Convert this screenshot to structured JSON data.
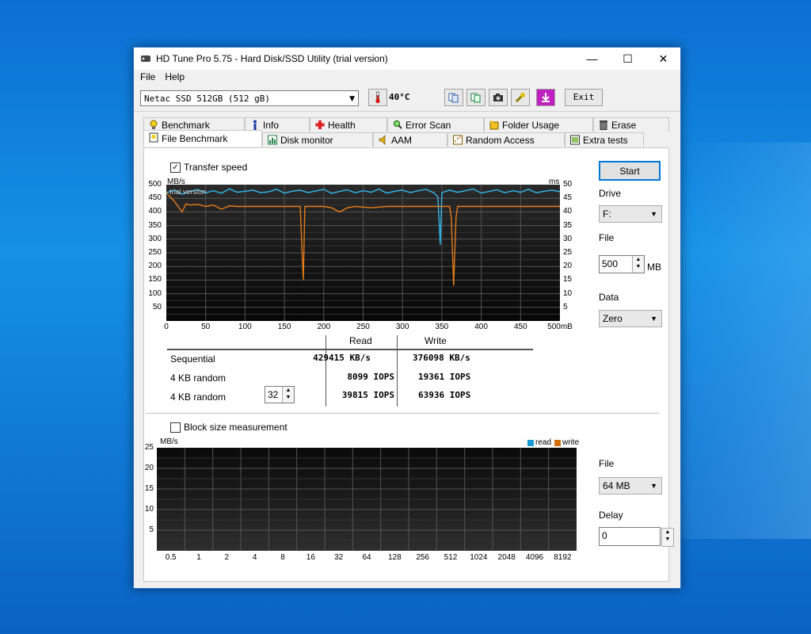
{
  "window": {
    "title": "HD Tune Pro 5.75 - Hard Disk/SSD Utility (trial version)",
    "minimize_glyph": "—",
    "maximize_glyph": "☐",
    "close_glyph": "✕"
  },
  "menu": {
    "file": "File",
    "help": "Help"
  },
  "toolbar": {
    "drive": "Netac SSD 512GB (512 gB)",
    "temperature": "40",
    "exit_label": "Exit"
  },
  "tabs": {
    "row1": [
      "Benchmark",
      "Info",
      "Health",
      "Error Scan",
      "Folder Usage",
      "Erase"
    ],
    "row2": [
      "File Benchmark",
      "Disk monitor",
      "AAM",
      "Random Access",
      "Extra tests"
    ]
  },
  "file_benchmark": {
    "transfer_speed_label": "Transfer speed",
    "left_unit": "MB/s",
    "right_unit": "ms",
    "watermark": "trial version",
    "x_ticks": [
      "0",
      "50",
      "100",
      "150",
      "200",
      "250",
      "300",
      "350",
      "400",
      "450",
      "500mB"
    ],
    "y_left_ticks": [
      "500",
      "450",
      "400",
      "350",
      "300",
      "250",
      "200",
      "150",
      "100",
      "50"
    ],
    "y_right_ticks": [
      "50",
      "45",
      "40",
      "35",
      "30",
      "25",
      "20",
      "15",
      "10",
      "5"
    ],
    "results": {
      "read_header": "Read",
      "write_header": "Write",
      "rows": [
        {
          "label": "Sequential",
          "read": "429415 KB/s",
          "write": "376098 KB/s"
        },
        {
          "label": "4 KB random",
          "read": "8099 IOPS",
          "write": "19361 IOPS"
        },
        {
          "label": "4 KB random",
          "read": "39815 IOPS",
          "write": "63936 IOPS"
        }
      ],
      "queue_depth": "32"
    },
    "start_label": "Start",
    "drive_label": "Drive",
    "drive_value": "F:",
    "file_label": "File",
    "file_size": "500",
    "file_unit": "MB",
    "data_label": "Data",
    "data_value": "Zero",
    "block_size_label": "Block size measurement",
    "block_unit": "MB/s",
    "block_y_ticks": [
      "25",
      "20",
      "15",
      "10",
      "5"
    ],
    "block_x_ticks": [
      "0.5",
      "1",
      "2",
      "4",
      "8",
      "16",
      "32",
      "64",
      "128",
      "256",
      "512",
      "1024",
      "2048",
      "4096",
      "8192"
    ],
    "legend_read": "read",
    "legend_write": "write",
    "block_file_label": "File",
    "block_file_value": "64 MB",
    "delay_label": "Delay",
    "delay_value": "0"
  },
  "chart_data": {
    "type": "line",
    "xlabel": "mB",
    "ylabel": "MB/s",
    "xlim": [
      0,
      500
    ],
    "ylim": [
      0,
      500
    ],
    "series": [
      {
        "name": "read",
        "color": "#30b8ec",
        "x": [
          0,
          10,
          20,
          30,
          40,
          50,
          60,
          70,
          80,
          90,
          100,
          110,
          120,
          130,
          140,
          150,
          160,
          170,
          180,
          190,
          200,
          210,
          220,
          230,
          240,
          250,
          260,
          270,
          280,
          290,
          300,
          310,
          320,
          330,
          340,
          345,
          348,
          350,
          355,
          360,
          370,
          380,
          390,
          400,
          410,
          420,
          430,
          440,
          450,
          460,
          470,
          480,
          490,
          500
        ],
        "y": [
          470,
          480,
          465,
          475,
          482,
          470,
          478,
          468,
          485,
          472,
          476,
          480,
          470,
          474,
          483,
          469,
          476,
          480,
          471,
          477,
          483,
          468,
          475,
          481,
          470,
          478,
          472,
          484,
          469,
          476,
          480,
          471,
          478,
          483,
          470,
          455,
          280,
          470,
          476,
          480,
          472,
          478,
          484,
          469,
          475,
          481,
          470,
          478,
          472,
          483,
          470,
          476,
          480,
          474
        ]
      },
      {
        "name": "write",
        "color": "#e57c1b",
        "x": [
          0,
          10,
          15,
          20,
          25,
          30,
          40,
          50,
          60,
          70,
          80,
          90,
          100,
          120,
          140,
          160,
          170,
          174,
          176,
          180,
          190,
          200,
          210,
          220,
          230,
          240,
          260,
          280,
          300,
          320,
          340,
          360,
          362,
          365,
          368,
          370,
          380,
          390,
          400,
          420,
          440,
          460,
          480,
          500
        ],
        "y": [
          470,
          440,
          420,
          400,
          430,
          425,
          428,
          420,
          425,
          410,
          422,
          420,
          420,
          420,
          420,
          420,
          420,
          150,
          420,
          420,
          420,
          420,
          415,
          400,
          415,
          420,
          415,
          420,
          420,
          420,
          420,
          420,
          380,
          130,
          380,
          420,
          420,
          420,
          420,
          420,
          420,
          420,
          420,
          420
        ]
      }
    ]
  },
  "colors": {
    "read": "#30b8ec",
    "write": "#e57c1b"
  }
}
